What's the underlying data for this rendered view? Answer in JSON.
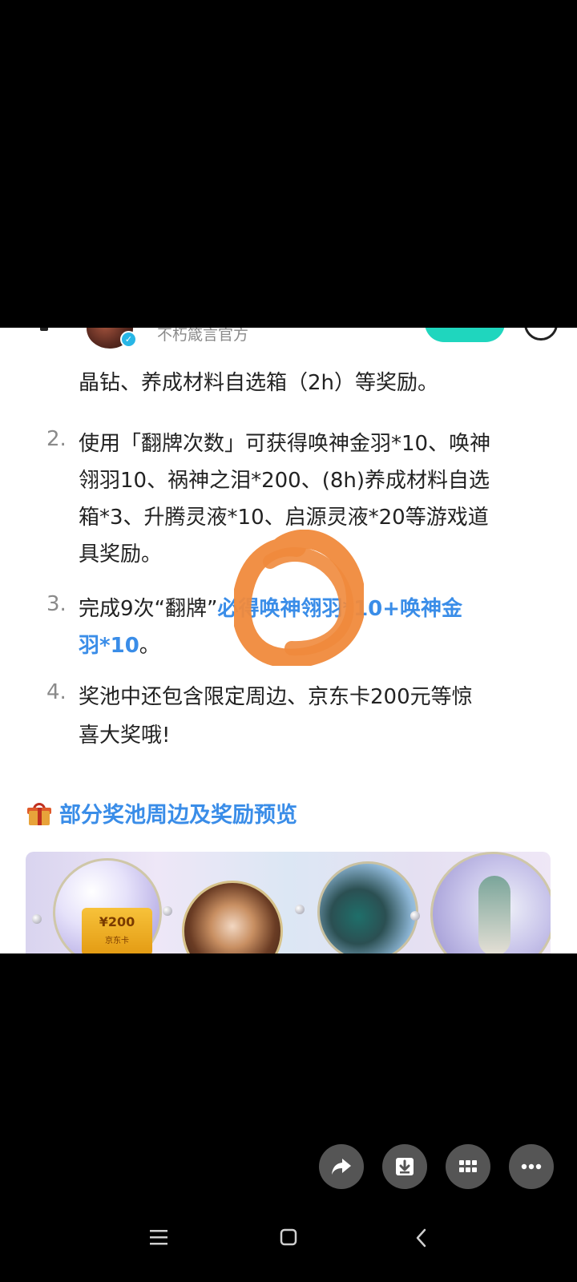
{
  "header": {
    "account_name": "不朽箴言官方"
  },
  "list": {
    "item1_tail": "晶钻、养成材料自选箱（2h）等奖励。",
    "item2_number": "2.",
    "item2_lines": [
      "使用「翻牌次数」可获得唤神金羽*10、唤神",
      "翎羽10、祸神之泪*200、(8h)养成材料自选",
      "箱*3、升腾灵液*10、启源灵液*20等游戏道",
      "具奖励。"
    ],
    "item3_number": "3.",
    "item3_prefix": "完成9次“翻牌”",
    "item3_highlight_1": "必得唤神翎羽*10+唤神金",
    "item3_highlight_2": "羽*10",
    "item3_suffix": "。",
    "item4_number": "4.",
    "item4_lines": [
      "奖池中还包含限定周边、京东卡200元等惊",
      "喜大奖哦!"
    ]
  },
  "section": {
    "title": "部分奖池周边及奖励预览"
  },
  "gallery": {
    "card_value": "¥200",
    "card_sub": "京东卡"
  },
  "controls": {
    "share_icon": "share-icon",
    "download_icon": "download-icon",
    "grid_icon": "grid-icon",
    "more_icon": "more-icon"
  },
  "colors": {
    "highlight": "#3a8de8",
    "annotation": "#f08a3c",
    "follow_button": "#1fd6be"
  }
}
